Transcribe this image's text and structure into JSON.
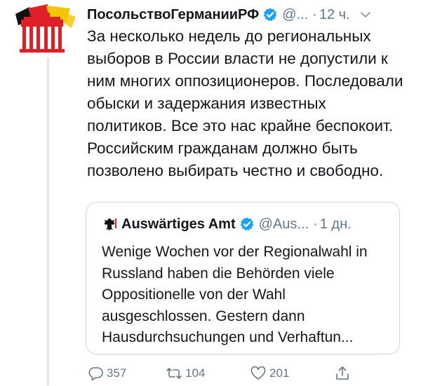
{
  "tweet": {
    "author_name": "ПосольствоГерманииРФ",
    "handle": "@...",
    "separator": "·",
    "time": "12 ч.",
    "text": "За несколько недель до региональных выборов в России власти не допустили к ним многих оппозиционеров. Последовали обыски и задержания известных политиков. Все это нас крайне беспокоит. Российским гражданам должно быть позволено выбирать честно и свободно."
  },
  "quoted_tweet": {
    "author_name": "Auswärtiges Amt",
    "handle": "@Aus...",
    "separator": "·",
    "time": "1 дн.",
    "text": "Wenige Wochen vor der Regionalwahl in Russland haben die Behörden viele Oppositionelle von der Wahl ausgeschlossen. Gestern dann Hausdurchsuchungen und Verhaftun..."
  },
  "actions": {
    "replies": "357",
    "retweets": "104",
    "likes": "201"
  },
  "icons": {
    "verified": "verified-badge-icon",
    "reply": "reply-icon",
    "retweet": "retweet-icon",
    "like": "heart-icon",
    "share": "share-icon",
    "more": "chevron-down-icon",
    "quoted_avatar": "federal-eagle-icon"
  },
  "colors": {
    "verified_blue": "#1da1f2",
    "secondary_text": "#657786",
    "primary_text": "#14171a",
    "border": "#ccd6dd",
    "avatar_black": "#111111",
    "avatar_red": "#dd1f26",
    "avatar_gold": "#f5c400"
  }
}
